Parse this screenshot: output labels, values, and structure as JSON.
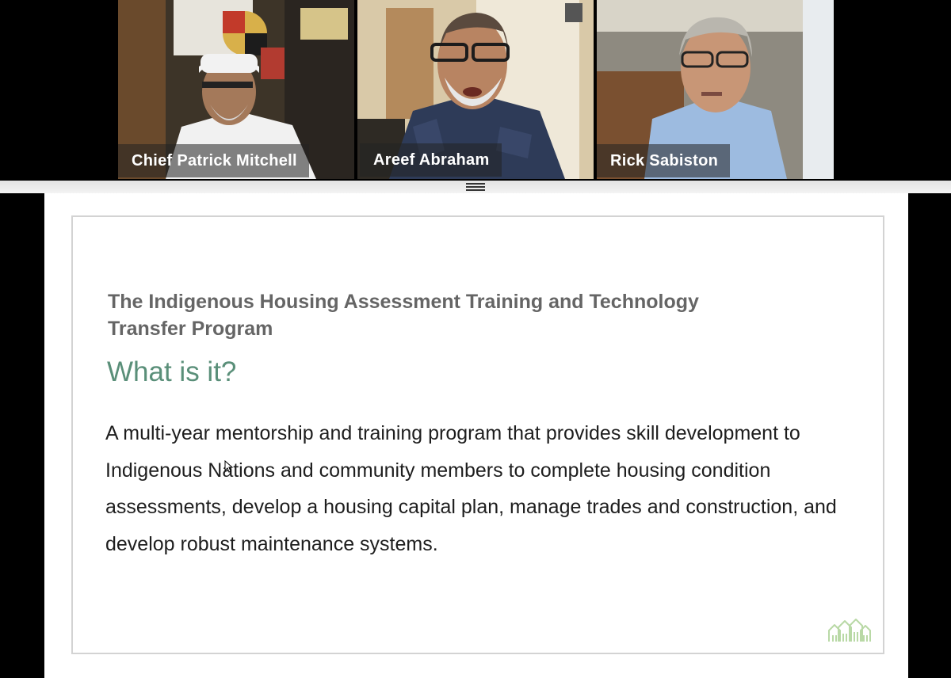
{
  "participants": [
    {
      "name": "Chief Patrick Mitchell",
      "active": false
    },
    {
      "name": "Areef Abraham",
      "active": true
    },
    {
      "name": "Rick Sabiston",
      "active": false
    }
  ],
  "colors": {
    "active_speaker_border": "#2fbf71",
    "slide_heading": "#656565",
    "slide_subheading": "#5a8f79",
    "slide_body": "#1e1e1e",
    "logo": "#b9d9a6"
  },
  "splitter": {
    "icon": "drag-handle-icon"
  },
  "slide": {
    "heading": "The Indigenous Housing Assessment Training and Technology Transfer Program",
    "subheading": "What is it?",
    "body": "A multi-year mentorship and training program that provides skill development to Indigenous Nations and community members to complete housing condition assessments, develop a housing capital plan, manage trades and construction, and develop robust maintenance systems.",
    "logo_icon": "houses-logo-icon"
  },
  "cursor_icon": "mouse-pointer-icon"
}
